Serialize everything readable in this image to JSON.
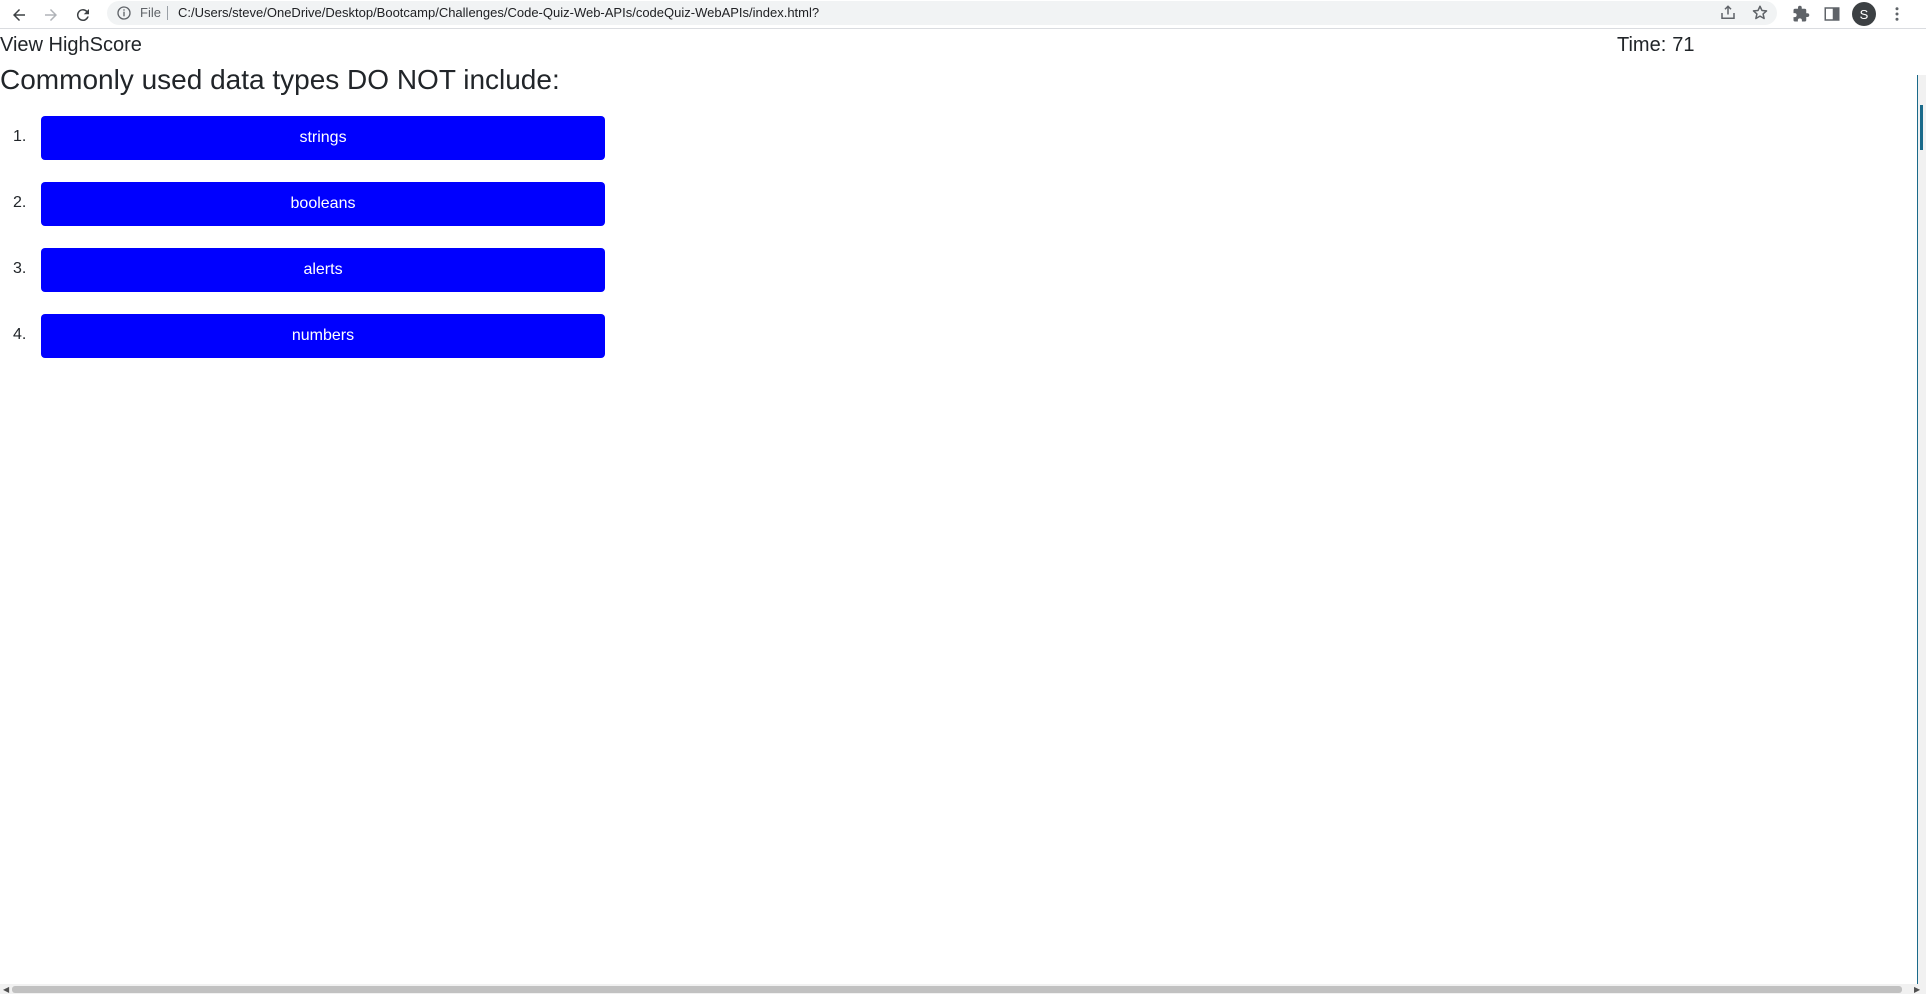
{
  "browser": {
    "scheme_label": "File",
    "url": "C:/Users/steve/OneDrive/Desktop/Bootcamp/Challenges/Code-Quiz-Web-APIs/codeQuiz-WebAPIs/index.html?",
    "profile_initial": "S"
  },
  "header": {
    "view_highscore": "View HighScore",
    "time_label": "Time:",
    "time_value": "71"
  },
  "quiz": {
    "question": "Commonly used data types DO NOT include:",
    "choices": [
      {
        "number": "1.",
        "label": "strings"
      },
      {
        "number": "2.",
        "label": "booleans"
      },
      {
        "number": "3.",
        "label": "alerts"
      },
      {
        "number": "4.",
        "label": "numbers"
      }
    ],
    "button_color": "#0000ff"
  }
}
